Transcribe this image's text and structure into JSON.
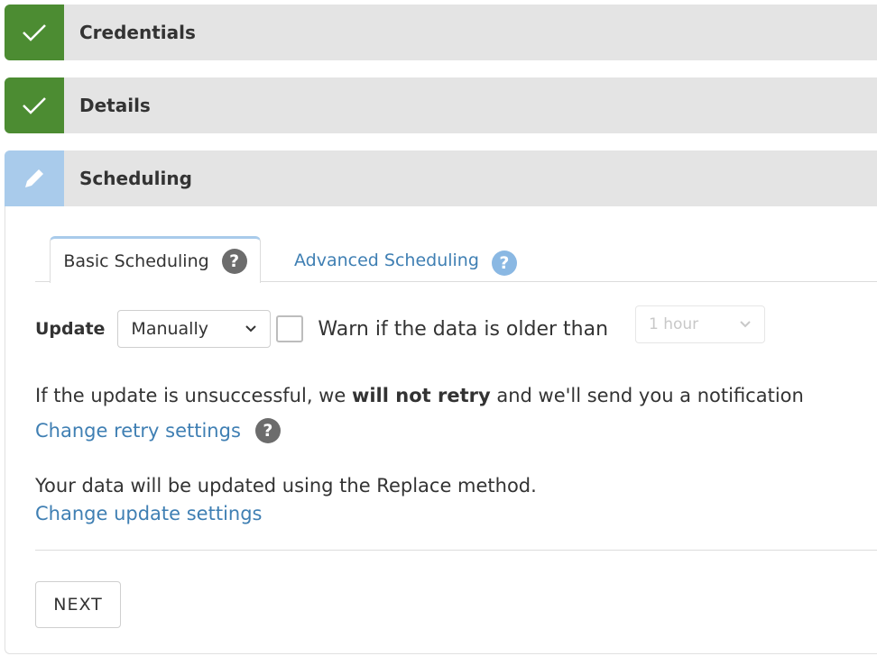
{
  "steps": [
    {
      "title": "Credentials",
      "status": "done",
      "icon": "check-icon"
    },
    {
      "title": "Details",
      "status": "done",
      "icon": "check-icon"
    },
    {
      "title": "Scheduling",
      "status": "editing",
      "icon": "pencil-icon"
    }
  ],
  "tabs": {
    "basic": {
      "label": "Basic Scheduling",
      "help": "?"
    },
    "advanced": {
      "label": "Advanced Scheduling",
      "help": "?"
    }
  },
  "update": {
    "label": "Update",
    "select_value": "Manually",
    "warn_label": "Warn if the data is older than",
    "age_value": "1 hour"
  },
  "retry": {
    "text_before": "If the update is unsuccessful, we ",
    "text_bold": "will not retry",
    "text_after": " and we'll send you a notification",
    "link": "Change retry settings",
    "help": "?"
  },
  "method": {
    "text": "Your data will be updated using the Replace method.",
    "link": "Change update settings"
  },
  "actions": {
    "next": "NEXT"
  },
  "colors": {
    "done": "#4c8c32",
    "editing": "#a9cbeb",
    "link": "#3f7fb3"
  }
}
